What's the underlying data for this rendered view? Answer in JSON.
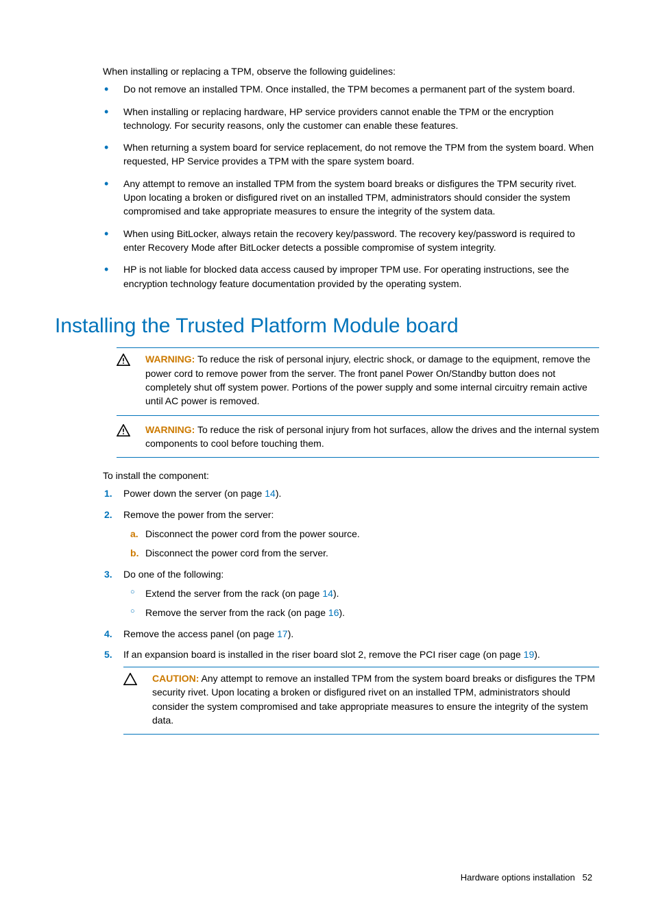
{
  "intro": "When installing or replacing a TPM, observe the following guidelines:",
  "bullets": [
    "Do not remove an installed TPM. Once installed, the TPM becomes a permanent part of the system board.",
    "When installing or replacing hardware, HP service providers cannot enable the TPM or the encryption technology. For security reasons, only the customer can enable these features.",
    "When returning a system board for service replacement, do not remove the TPM from the system board. When requested, HP Service provides a TPM with the spare system board.",
    "Any attempt to remove an installed TPM from the system board breaks or disfigures the TPM security rivet. Upon locating a broken or disfigured rivet on an installed TPM, administrators should consider the system compromised and take appropriate measures to ensure the integrity of the system data.",
    "When using BitLocker, always retain the recovery key/password. The recovery key/password is required to enter Recovery Mode after BitLocker detects a possible compromise of system integrity.",
    "HP is not liable for blocked data access caused by improper TPM use. For operating instructions, see the encryption technology feature documentation provided by the operating system."
  ],
  "heading": "Installing the Trusted Platform Module board",
  "warnings": [
    {
      "label": "WARNING:",
      "text": " To reduce the risk of personal injury, electric shock, or damage to the equipment, remove the power cord to remove power from the server. The front panel Power On/Standby button does not completely shut off system power. Portions of the power supply and some internal circuitry remain active until AC power is removed."
    },
    {
      "label": "WARNING:",
      "text": " To reduce the risk of personal injury from hot surfaces, allow the drives and the internal system components to cool before touching them."
    }
  ],
  "install_lead": "To install the component:",
  "steps": {
    "s1_pre": "Power down the server (on page ",
    "s1_ref": "14",
    "s1_post": ").",
    "s2": "Remove the power from the server:",
    "s2a": "Disconnect the power cord from the power source.",
    "s2b": "Disconnect the power cord from the server.",
    "s3": "Do one of the following:",
    "s3o1_pre": "Extend the server from the rack (on page ",
    "s3o1_ref": "14",
    "s3o1_post": ").",
    "s3o2_pre": "Remove the server from the rack (on page ",
    "s3o2_ref": "16",
    "s3o2_post": ").",
    "s4_pre": "Remove the access panel (on page ",
    "s4_ref": "17",
    "s4_post": ").",
    "s5_pre": "If an expansion board is installed in the riser board slot 2, remove the PCI riser cage (on page ",
    "s5_ref": "19",
    "s5_post": ")."
  },
  "caution": {
    "label": "CAUTION:",
    "text": " Any attempt to remove an installed TPM from the system board breaks or disfigures the TPM security rivet. Upon locating a broken or disfigured rivet on an installed TPM, administrators should consider the system compromised and take appropriate measures to ensure the integrity of the system data."
  },
  "footer_section": "Hardware options installation",
  "footer_page": "52"
}
